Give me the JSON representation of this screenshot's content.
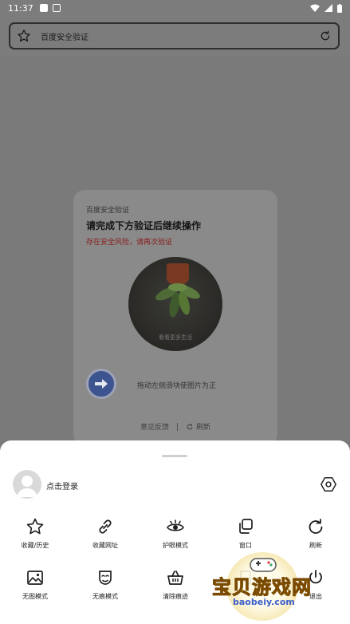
{
  "status_bar": {
    "time": "11:37"
  },
  "address_bar": {
    "title": "百度安全验证"
  },
  "verify_card": {
    "subtitle": "百度安全验证",
    "heading": "请完成下方验证后继续操作",
    "warning": "存在安全风险，请再次验证",
    "image_caption": "看看更多生活",
    "slider_hint": "拖动左侧滑块使图片为正",
    "feedback": "意见反馈",
    "refresh": "刷新"
  },
  "sheet": {
    "login_label": "点击登录",
    "items": [
      {
        "label": "收藏/历史",
        "icon": "star-icon"
      },
      {
        "label": "收藏网址",
        "icon": "link-icon"
      },
      {
        "label": "护眼模式",
        "icon": "eye-icon"
      },
      {
        "label": "窗口",
        "icon": "windows-icon"
      },
      {
        "label": "刷新",
        "icon": "refresh-icon"
      },
      {
        "label": "无图模式",
        "icon": "image-icon"
      },
      {
        "label": "无痕模式",
        "icon": "mask-icon"
      },
      {
        "label": "清除痕迹",
        "icon": "basket-icon"
      },
      {
        "label": "",
        "icon": "bookmark-icon"
      },
      {
        "label": "退出",
        "icon": "power-icon"
      }
    ]
  },
  "watermark": {
    "text": "宝贝游戏网",
    "url": "baobeiy.com"
  }
}
